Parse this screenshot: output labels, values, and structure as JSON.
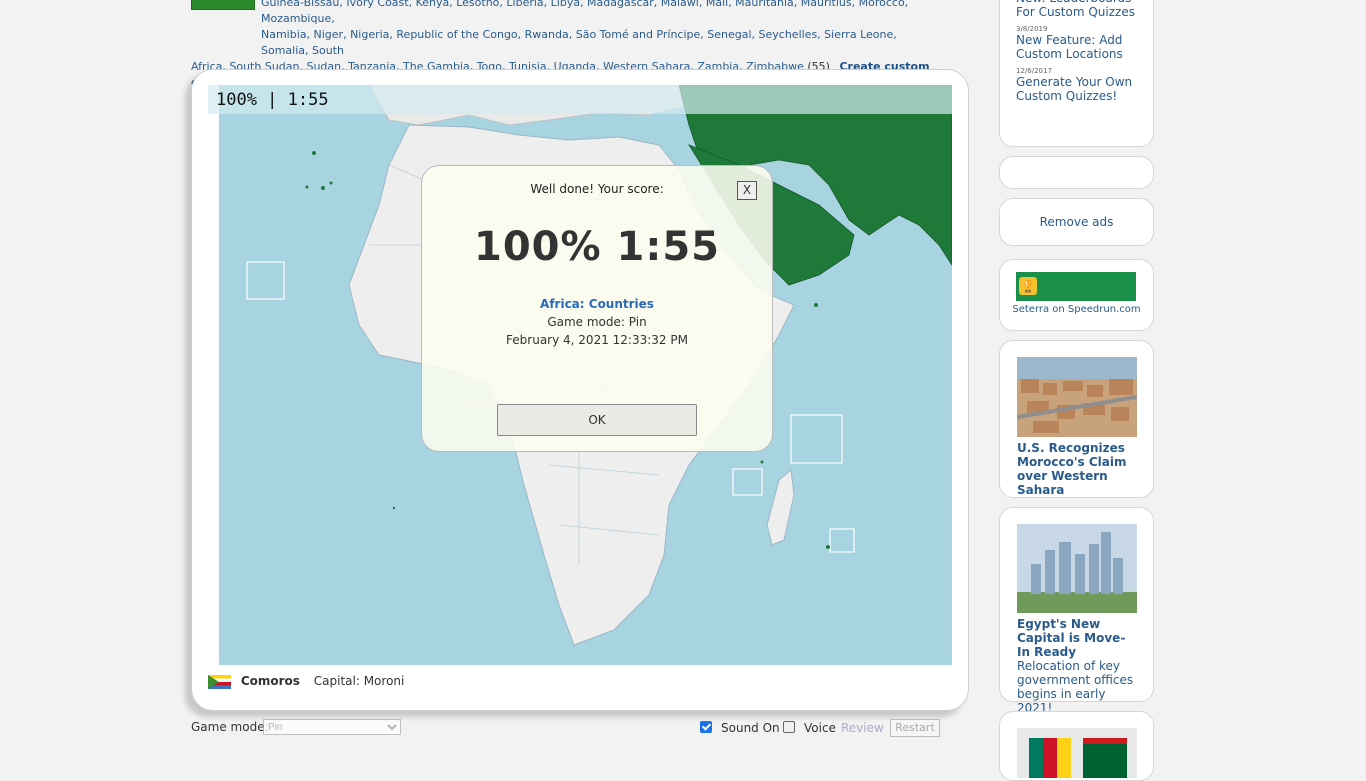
{
  "top_country_list": {
    "row1": "Guinea-Bissau, Ivory Coast, Kenya, Lesotho, Liberia, Libya, Madagascar, Malawi, Mali, Mauritania, Mauritius, Morocco, Mozambique,",
    "row2": "Namibia, Niger, Nigeria, Republic of the Congo, Rwanda, São Tomé and Príncipe, Senegal, Seychelles, Sierra Leone, Somalia, South",
    "row3": "Africa, South Sudan, Sudan, Tanzania, The Gambia, Togo, Tunisia, Uganda, Western Sahara, Zambia, Zimbabwe",
    "count": "(55)",
    "create_quiz": "Create custom quiz"
  },
  "game": {
    "score_bar": "100% | 1:55",
    "dialog": {
      "heading": "Well done! Your score:",
      "close_label": "X",
      "big_score": "100% 1:55",
      "quiz_name": "Africa: Countries",
      "game_mode": "Game mode: Pin",
      "date": "February 4, 2021  12:33:32 PM",
      "ok_label": "OK"
    },
    "current": {
      "country": "Comoros",
      "capital": "Capital: Moroni"
    }
  },
  "controls": {
    "game_mode_label": "Game mode:",
    "game_mode_value": "Pin",
    "sound_label": "Sound On",
    "sound_checked": true,
    "voice_label": "Voice",
    "voice_checked": false,
    "review_label": "Review",
    "restart_label": "Restart"
  },
  "sidebar": {
    "news": [
      {
        "date": "",
        "title": "New: Leaderboards For Custom Quizzes"
      },
      {
        "date": "3/8/2019",
        "title": "New Feature: Add Custom Locations"
      },
      {
        "date": "12/6/2017",
        "title": "Generate Your Own Custom Quizzes!"
      }
    ],
    "remove_ads": "Remove ads",
    "speedrun_logo": "SPEEDRUN.COM",
    "speedrun_caption": "Seterra on Speedrun.com",
    "article1_title": "U.S. Recognizes Morocco's Claim over Western Sahara",
    "article2_title": "Egypt's New Capital is Move-In Ready",
    "article2_desc": "Relocation of key government offices begins in early 2021!"
  },
  "colors": {
    "ocean": "#a8d3e0",
    "land": "#eeeeee",
    "asia_green": "#1f7a3a",
    "link": "#2a5b8c"
  }
}
